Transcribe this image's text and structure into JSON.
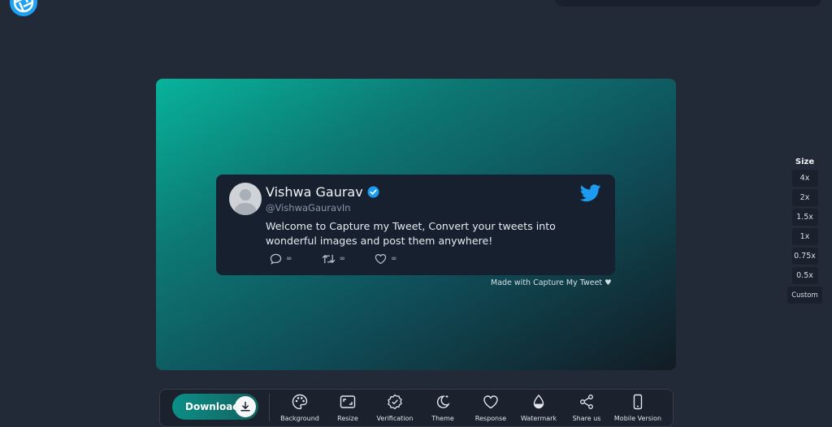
{
  "header": {
    "logo_icon": "camera-shutter-icon"
  },
  "tweet": {
    "author_name": "Vishwa Gaurav",
    "handle": "@VishwaGauravIn",
    "text": "Welcome to Capture my Tweet, Convert your tweets into wonderful images and post them anywhere!",
    "reply_count": "∞",
    "retweet_count": "∞",
    "like_count": "∞",
    "brand_color": "#1d9bf0"
  },
  "watermark": {
    "text": "Made with Capture My Tweet",
    "heart": "♥"
  },
  "size_panel": {
    "title": "Size",
    "options": [
      "4x",
      "2x",
      "1.5x",
      "1x",
      "0.75x",
      "0.5x",
      "Custom"
    ]
  },
  "toolbar": {
    "download_label": "Download",
    "tools": [
      "Background",
      "Resize",
      "Verification",
      "Theme",
      "Response",
      "Watermark",
      "Share us",
      "Mobile Version"
    ]
  }
}
